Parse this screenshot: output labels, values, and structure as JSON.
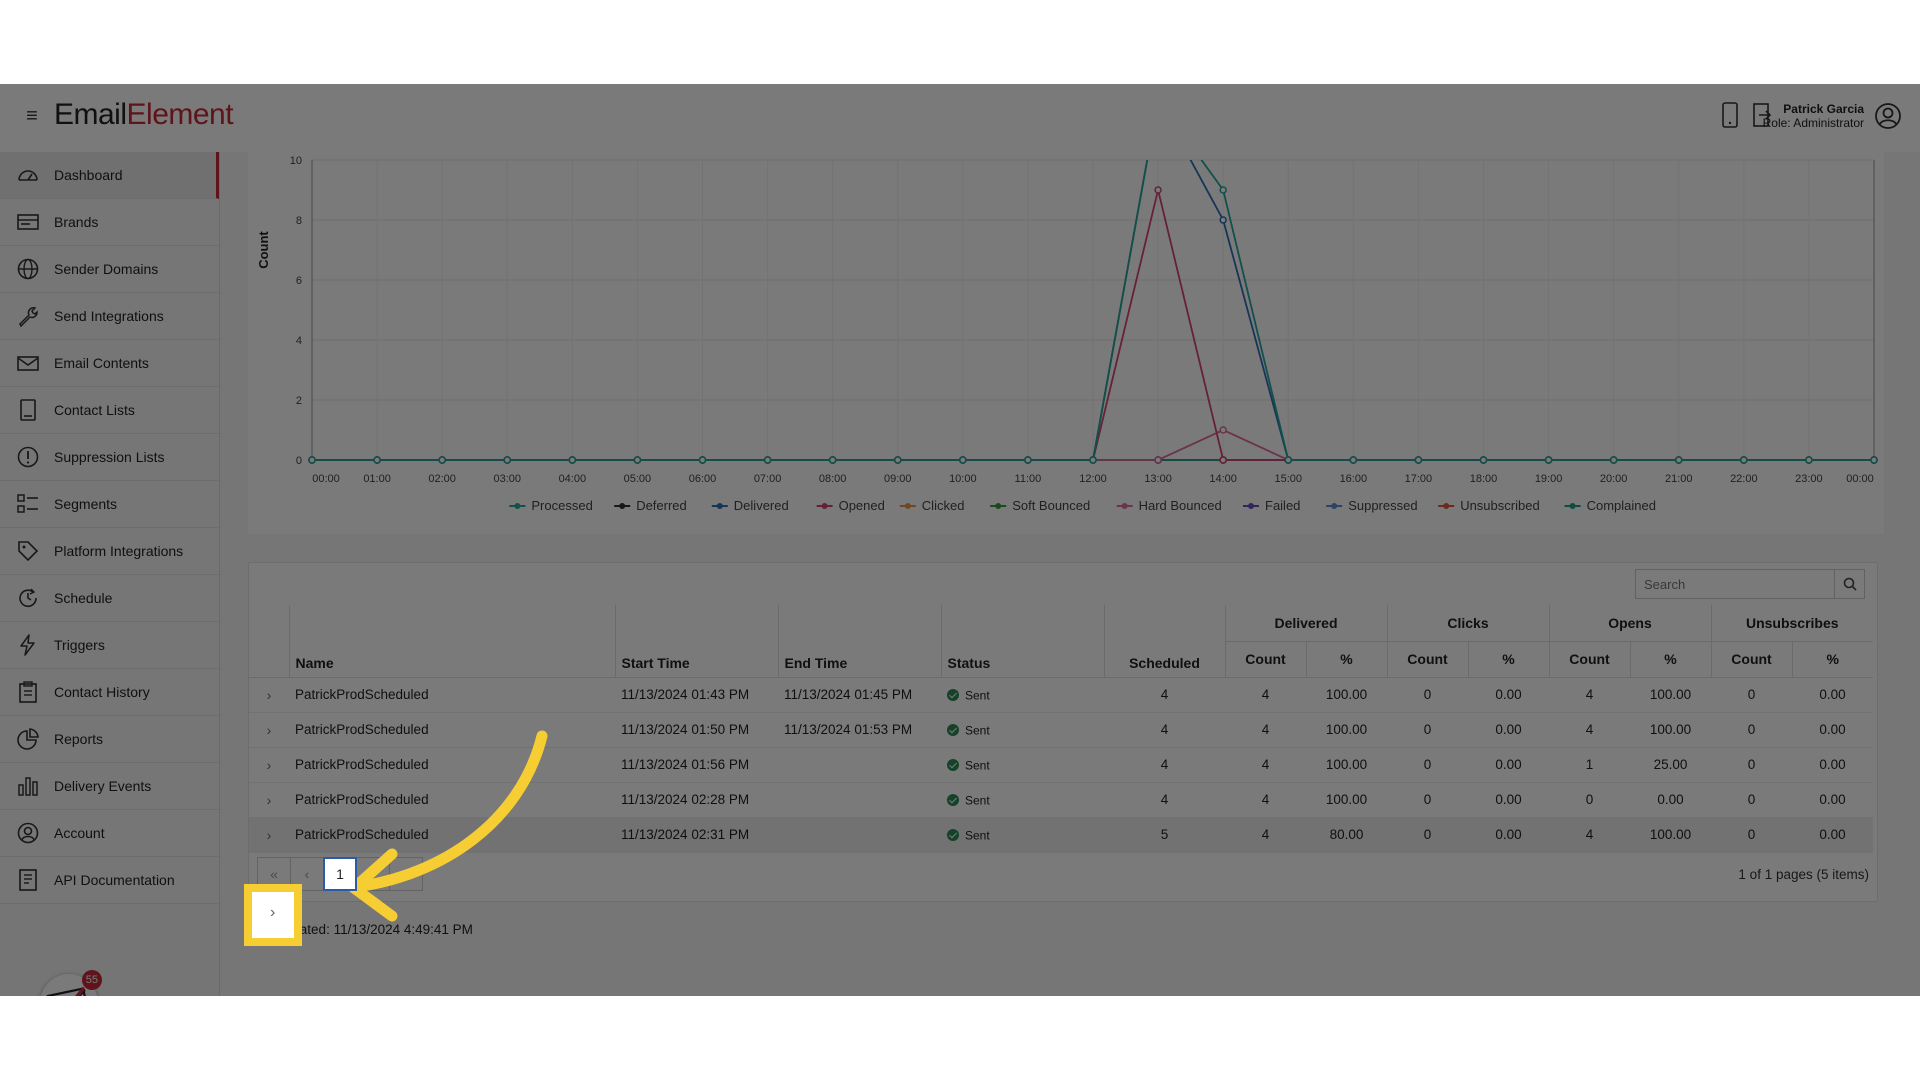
{
  "header": {
    "logo_part1": "Email",
    "logo_part2": "Element",
    "user_name": "Patrick Garcia",
    "user_role": "Role: Administrator"
  },
  "sidebar": {
    "items": [
      {
        "label": "Dashboard",
        "icon": "speedometer-icon"
      },
      {
        "label": "Brands",
        "icon": "brand-card-icon"
      },
      {
        "label": "Sender Domains",
        "icon": "globe-icon"
      },
      {
        "label": "Send Integrations",
        "icon": "wrench-icon"
      },
      {
        "label": "Email Contents",
        "icon": "envelope-icon"
      },
      {
        "label": "Contact Lists",
        "icon": "contact-book-icon"
      },
      {
        "label": "Suppression Lists",
        "icon": "exclamation-circle-icon"
      },
      {
        "label": "Segments",
        "icon": "segments-list-icon"
      },
      {
        "label": "Platform Integrations",
        "icon": "tag-icon"
      },
      {
        "label": "Schedule",
        "icon": "clock-icon"
      },
      {
        "label": "Triggers",
        "icon": "lightning-icon"
      },
      {
        "label": "Contact History",
        "icon": "clipboard-icon"
      },
      {
        "label": "Reports",
        "icon": "pie-chart-icon"
      },
      {
        "label": "Delivery Events",
        "icon": "bar-chart-icon"
      },
      {
        "label": "Account",
        "icon": "user-circle-icon"
      },
      {
        "label": "API Documentation",
        "icon": "document-icon"
      }
    ],
    "notification_count": "55"
  },
  "chart_data": {
    "type": "line",
    "title": "",
    "xlabel": "",
    "ylabel": "Count",
    "ylim": [
      0,
      10
    ],
    "y_ticks": [
      "0",
      "2",
      "4",
      "6",
      "8",
      "10"
    ],
    "categories": [
      "00:00",
      "01:00",
      "02:00",
      "03:00",
      "04:00",
      "05:00",
      "06:00",
      "07:00",
      "08:00",
      "09:00",
      "10:00",
      "11:00",
      "12:00",
      "13:00",
      "14:00",
      "15:00",
      "16:00",
      "17:00",
      "18:00",
      "19:00",
      "20:00",
      "21:00",
      "22:00",
      "23:00",
      "00:00"
    ],
    "legend_position": "bottom",
    "grid": true,
    "series": [
      {
        "name": "Processed",
        "color": "#27a79a",
        "values": [
          0,
          0,
          0,
          0,
          0,
          0,
          0,
          0,
          0,
          0,
          0,
          0,
          0,
          17,
          9,
          0,
          0,
          0,
          0,
          0,
          0,
          0,
          0,
          0,
          0
        ]
      },
      {
        "name": "Deferred",
        "color": "#333333",
        "values": [
          0,
          0,
          0,
          0,
          0,
          0,
          0,
          0,
          0,
          0,
          0,
          0,
          0,
          0,
          0,
          0,
          0,
          0,
          0,
          0,
          0,
          0,
          0,
          0,
          0
        ]
      },
      {
        "name": "Delivered",
        "color": "#2f6fb8",
        "values": [
          0,
          0,
          0,
          0,
          0,
          0,
          0,
          0,
          0,
          0,
          0,
          0,
          0,
          16,
          8,
          0,
          0,
          0,
          0,
          0,
          0,
          0,
          0,
          0,
          0
        ]
      },
      {
        "name": "Opened",
        "color": "#d6437a",
        "values": [
          0,
          0,
          0,
          0,
          0,
          0,
          0,
          0,
          0,
          0,
          0,
          0,
          0,
          9,
          0,
          0,
          0,
          0,
          0,
          0,
          0,
          0,
          0,
          0,
          0
        ]
      },
      {
        "name": "Clicked",
        "color": "#e8954a",
        "values": [
          0,
          0,
          0,
          0,
          0,
          0,
          0,
          0,
          0,
          0,
          0,
          0,
          0,
          0,
          0,
          0,
          0,
          0,
          0,
          0,
          0,
          0,
          0,
          0,
          0
        ]
      },
      {
        "name": "Soft Bounced",
        "color": "#3a9b3a",
        "values": [
          0,
          0,
          0,
          0,
          0,
          0,
          0,
          0,
          0,
          0,
          0,
          0,
          0,
          0,
          0,
          0,
          0,
          0,
          0,
          0,
          0,
          0,
          0,
          0,
          0
        ]
      },
      {
        "name": "Hard Bounced",
        "color": "#e06c9f",
        "values": [
          0,
          0,
          0,
          0,
          0,
          0,
          0,
          0,
          0,
          0,
          0,
          0,
          0,
          0,
          1,
          0,
          0,
          0,
          0,
          0,
          0,
          0,
          0,
          0,
          0
        ]
      },
      {
        "name": "Failed",
        "color": "#6b4fbb",
        "values": [
          0,
          0,
          0,
          0,
          0,
          0,
          0,
          0,
          0,
          0,
          0,
          0,
          0,
          0,
          0,
          0,
          0,
          0,
          0,
          0,
          0,
          0,
          0,
          0,
          0
        ]
      },
      {
        "name": "Suppressed",
        "color": "#5a8fd6",
        "values": [
          0,
          0,
          0,
          0,
          0,
          0,
          0,
          0,
          0,
          0,
          0,
          0,
          0,
          0,
          0,
          0,
          0,
          0,
          0,
          0,
          0,
          0,
          0,
          0,
          0
        ]
      },
      {
        "name": "Unsubscribed",
        "color": "#e05a3a",
        "values": [
          0,
          0,
          0,
          0,
          0,
          0,
          0,
          0,
          0,
          0,
          0,
          0,
          0,
          0,
          0,
          0,
          0,
          0,
          0,
          0,
          0,
          0,
          0,
          0,
          0
        ]
      },
      {
        "name": "Complained",
        "color": "#1f9f8a",
        "values": [
          0,
          0,
          0,
          0,
          0,
          0,
          0,
          0,
          0,
          0,
          0,
          0,
          0,
          0,
          0,
          0,
          0,
          0,
          0,
          0,
          0,
          0,
          0,
          0,
          0
        ]
      }
    ]
  },
  "grid": {
    "search_placeholder": "Search",
    "group_headers": [
      "Delivered",
      "Clicks",
      "Opens",
      "Unsubscribes"
    ],
    "headers": {
      "name": "Name",
      "start_time": "Start Time",
      "end_time": "End Time",
      "status": "Status",
      "scheduled": "Scheduled",
      "count": "Count",
      "percent": "%"
    },
    "rows": [
      {
        "name": "PatrickProdScheduled",
        "start": "11/13/2024 01:43 PM",
        "end": "11/13/2024 01:45 PM",
        "status": "Sent",
        "scheduled": "4",
        "del_count": "4",
        "del_pct": "100.00",
        "clk_count": "0",
        "clk_pct": "0.00",
        "opn_count": "4",
        "opn_pct": "100.00",
        "uns_count": "0",
        "uns_pct": "0.00"
      },
      {
        "name": "PatrickProdScheduled",
        "start": "11/13/2024 01:50 PM",
        "end": "11/13/2024 01:53 PM",
        "status": "Sent",
        "scheduled": "4",
        "del_count": "4",
        "del_pct": "100.00",
        "clk_count": "0",
        "clk_pct": "0.00",
        "opn_count": "4",
        "opn_pct": "100.00",
        "uns_count": "0",
        "uns_pct": "0.00"
      },
      {
        "name": "PatrickProdScheduled",
        "start": "11/13/2024 01:56 PM",
        "end": "",
        "status": "Sent",
        "scheduled": "4",
        "del_count": "4",
        "del_pct": "100.00",
        "clk_count": "0",
        "clk_pct": "0.00",
        "opn_count": "1",
        "opn_pct": "25.00",
        "uns_count": "0",
        "uns_pct": "0.00"
      },
      {
        "name": "PatrickProdScheduled",
        "start": "11/13/2024 02:28 PM",
        "end": "",
        "status": "Sent",
        "scheduled": "4",
        "del_count": "4",
        "del_pct": "100.00",
        "clk_count": "0",
        "clk_pct": "0.00",
        "opn_count": "0",
        "opn_pct": "0.00",
        "uns_count": "0",
        "uns_pct": "0.00"
      },
      {
        "name": "PatrickProdScheduled",
        "start": "11/13/2024 02:31 PM",
        "end": "",
        "status": "Sent",
        "scheduled": "5",
        "del_count": "4",
        "del_pct": "80.00",
        "clk_count": "0",
        "clk_pct": "0.00",
        "opn_count": "4",
        "opn_pct": "100.00",
        "uns_count": "0",
        "uns_pct": "0.00"
      }
    ],
    "pager": {
      "first": "«",
      "prev": "‹",
      "current": "1",
      "next": "›",
      "last": "»",
      "info": "1 of 1 pages (5 items)"
    }
  },
  "footer": {
    "last_updated": "Last updated: 11/13/2024 4:49:41 PM"
  },
  "colors": {
    "brand_red": "#c52b37",
    "highlight_yellow": "#f6cd33",
    "status_green": "#2e8b57"
  }
}
